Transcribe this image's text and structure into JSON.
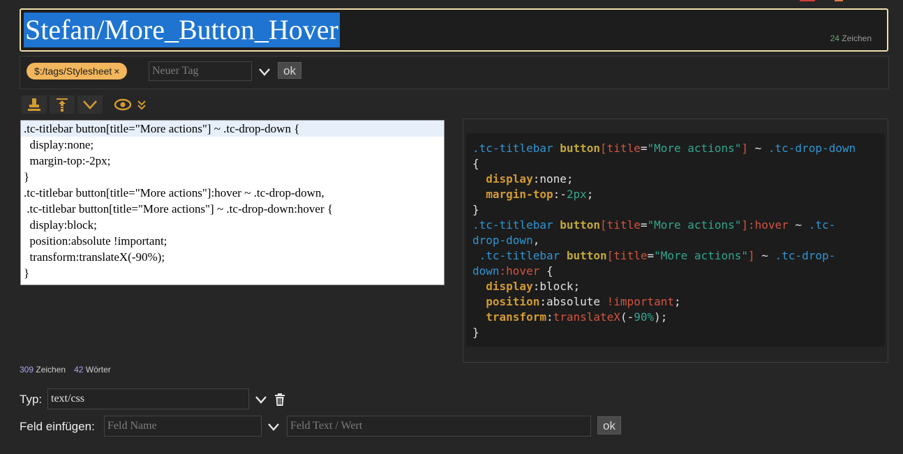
{
  "title": {
    "text": "Stefan/More_Button_Hover",
    "char_count": "24",
    "char_label": "Zeichen"
  },
  "tags": {
    "items": [
      {
        "label": "$:/tags/Stylesheet",
        "remove": "×"
      }
    ],
    "input_placeholder": "Neuer Tag",
    "ok_label": "ok"
  },
  "toolbar": {
    "icons": [
      "stamp-icon",
      "excise-icon",
      "more-chevron-icon",
      "preview-eye-icon",
      "preview-type-chevron-icon"
    ]
  },
  "editor": {
    "lines": [
      ".tc-titlebar button[title=\"More actions\"] ~ .tc-drop-down {",
      "  display:none;",
      "  margin-top:-2px;",
      "}",
      ".tc-titlebar button[title=\"More actions\"]:hover ~ .tc-drop-down,",
      " .tc-titlebar button[title=\"More actions\"] ~ .tc-drop-down:hover {",
      "  display:block;",
      "  position:absolute !important;",
      "  transform:translateX(-90%);",
      "}"
    ]
  },
  "preview": {
    "colors": {
      "selector": "#2f95d2",
      "tag": "#c3a93a",
      "punct": "#d5543e",
      "string": "#32a68e",
      "property": "#d29b32"
    },
    "lines": [
      [
        [
          "sel",
          ".tc-titlebar "
        ],
        [
          "tg",
          "button"
        ],
        [
          "pun",
          "["
        ],
        [
          "pun",
          "title"
        ],
        [
          "txt",
          "="
        ],
        [
          "str",
          "\"More actions\""
        ],
        [
          "pun",
          "]"
        ],
        [
          "txt",
          " ~ "
        ],
        [
          "sel",
          ".tc-drop-down"
        ]
      ],
      [
        [
          "txt",
          "{"
        ]
      ],
      [
        [
          "txt",
          "  "
        ],
        [
          "prop",
          "display"
        ],
        [
          "txt",
          ":none;"
        ]
      ],
      [
        [
          "txt",
          "  "
        ],
        [
          "prop",
          "margin-top"
        ],
        [
          "txt",
          ":-"
        ],
        [
          "num",
          "2px"
        ],
        [
          "txt",
          ";"
        ]
      ],
      [
        [
          "txt",
          "}"
        ]
      ],
      [
        [
          "sel",
          ".tc-titlebar "
        ],
        [
          "tg",
          "button"
        ],
        [
          "pun",
          "["
        ],
        [
          "pun",
          "title"
        ],
        [
          "txt",
          "="
        ],
        [
          "str",
          "\"More actions\""
        ],
        [
          "pun",
          "]"
        ],
        [
          "kw",
          ":hover"
        ],
        [
          "txt",
          " ~ "
        ],
        [
          "sel",
          ".tc-"
        ]
      ],
      [
        [
          "sel",
          "drop-down"
        ],
        [
          "txt",
          ","
        ]
      ],
      [
        [
          "txt",
          " "
        ],
        [
          "sel",
          ".tc-titlebar "
        ],
        [
          "tg",
          "button"
        ],
        [
          "pun",
          "["
        ],
        [
          "pun",
          "title"
        ],
        [
          "txt",
          "="
        ],
        [
          "str",
          "\"More actions\""
        ],
        [
          "pun",
          "]"
        ],
        [
          "txt",
          " ~ "
        ],
        [
          "sel",
          ".tc-drop-"
        ]
      ],
      [
        [
          "sel",
          "down"
        ],
        [
          "kw",
          ":hover"
        ],
        [
          "txt",
          " {"
        ]
      ],
      [
        [
          "txt",
          "  "
        ],
        [
          "prop",
          "display"
        ],
        [
          "txt",
          ":block;"
        ]
      ],
      [
        [
          "txt",
          "  "
        ],
        [
          "prop",
          "position"
        ],
        [
          "txt",
          ":absolute "
        ],
        [
          "kw",
          "!important"
        ],
        [
          "txt",
          ";"
        ]
      ],
      [
        [
          "txt",
          "  "
        ],
        [
          "prop",
          "transform"
        ],
        [
          "txt",
          ":"
        ],
        [
          "kw",
          "translateX"
        ],
        [
          "txt",
          "(-"
        ],
        [
          "num",
          "90%"
        ],
        [
          "txt",
          ");"
        ]
      ],
      [
        [
          "txt",
          "}"
        ]
      ]
    ]
  },
  "stats": {
    "chars": "309",
    "chars_label": "Zeichen",
    "words": "42",
    "words_label": "Wörter"
  },
  "type_row": {
    "label": "Typ:",
    "value": "text/css"
  },
  "field_row": {
    "label": "Feld einfügen:",
    "name_placeholder": "Feld Name",
    "value_placeholder": "Feld Text / Wert",
    "ok_label": "ok"
  }
}
